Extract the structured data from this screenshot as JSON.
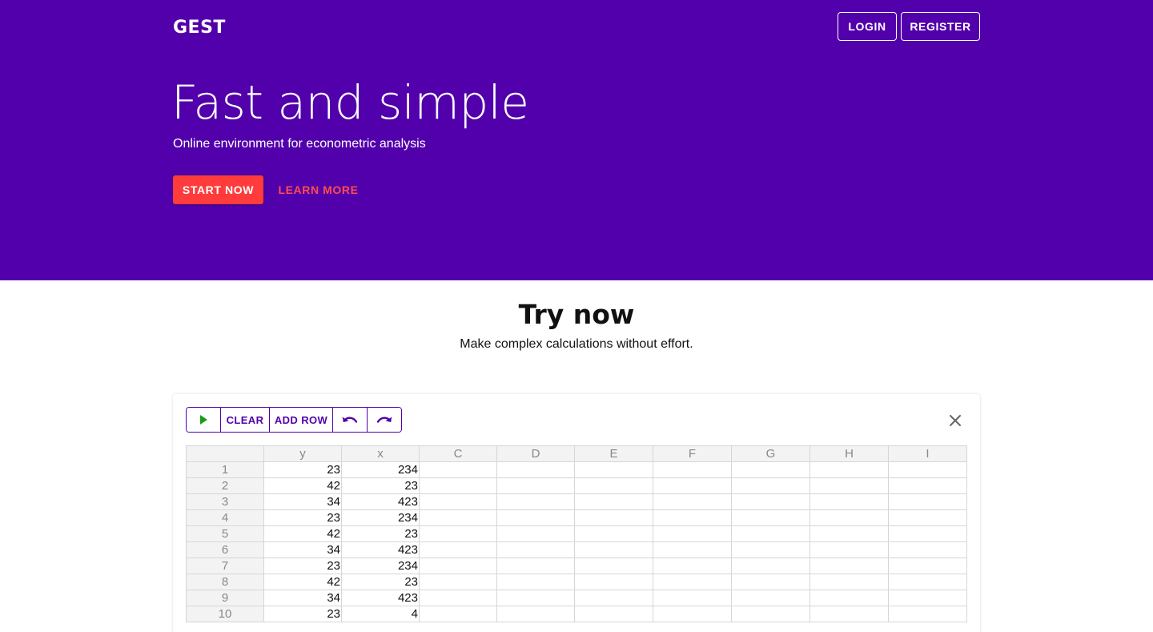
{
  "header": {
    "brand": "GEST",
    "login_label": "LOGIN",
    "register_label": "REGISTER"
  },
  "hero": {
    "title": "Fast and simple",
    "subtitle": "Online environment for econometric analysis",
    "start_label": "START NOW",
    "learn_label": "LEARN MORE"
  },
  "try_section": {
    "title": "Try now",
    "subtitle": "Make complex calculations without effort."
  },
  "toolbar": {
    "run_icon": "play-icon",
    "clear_label": "CLEAR",
    "add_row_label": "ADD ROW",
    "undo_icon": "undo-icon",
    "redo_icon": "redo-icon",
    "close_icon": "close-icon"
  },
  "sheet": {
    "columns": [
      "y",
      "x",
      "C",
      "D",
      "E",
      "F",
      "G",
      "H",
      "I"
    ],
    "rows": [
      {
        "num": "1",
        "cells": [
          "23",
          "234",
          "",
          "",
          "",
          "",
          "",
          "",
          ""
        ]
      },
      {
        "num": "2",
        "cells": [
          "42",
          "23",
          "",
          "",
          "",
          "",
          "",
          "",
          ""
        ]
      },
      {
        "num": "3",
        "cells": [
          "34",
          "423",
          "",
          "",
          "",
          "",
          "",
          "",
          ""
        ]
      },
      {
        "num": "4",
        "cells": [
          "23",
          "234",
          "",
          "",
          "",
          "",
          "",
          "",
          ""
        ]
      },
      {
        "num": "5",
        "cells": [
          "42",
          "23",
          "",
          "",
          "",
          "",
          "",
          "",
          ""
        ]
      },
      {
        "num": "6",
        "cells": [
          "34",
          "423",
          "",
          "",
          "",
          "",
          "",
          "",
          ""
        ]
      },
      {
        "num": "7",
        "cells": [
          "23",
          "234",
          "",
          "",
          "",
          "",
          "",
          "",
          ""
        ]
      },
      {
        "num": "8",
        "cells": [
          "42",
          "23",
          "",
          "",
          "",
          "",
          "",
          "",
          ""
        ]
      },
      {
        "num": "9",
        "cells": [
          "34",
          "423",
          "",
          "",
          "",
          "",
          "",
          "",
          ""
        ]
      },
      {
        "num": "10",
        "cells": [
          "23",
          "4",
          "",
          "",
          "",
          "",
          "",
          "",
          ""
        ]
      }
    ]
  },
  "colors": {
    "primary": "#5200ab",
    "accent": "#ff3b3b",
    "run_green": "#1a9c1a"
  }
}
